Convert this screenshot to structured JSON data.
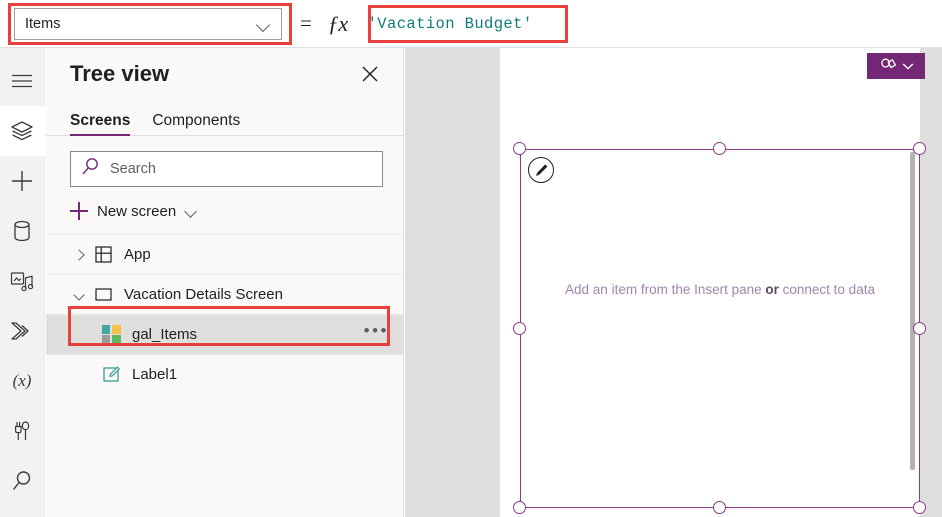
{
  "formula_bar": {
    "property_label": "Items",
    "property_options": [
      "Items"
    ],
    "equals_symbol": "=",
    "fx_symbol": "ƒx",
    "formula_value": "'Vacation Budget'",
    "formula_placeholder": "",
    "dropdown_icon": "chevron-down-icon"
  },
  "rail": {
    "items": [
      {
        "name": "hamburger-menu",
        "icon": "hamburger-icon",
        "active": false
      },
      {
        "name": "tree-view",
        "icon": "layers-icon",
        "active": true
      },
      {
        "name": "insert",
        "icon": "plus-icon",
        "active": false
      },
      {
        "name": "data",
        "icon": "database-icon",
        "active": false
      },
      {
        "name": "media",
        "icon": "media-icon",
        "active": false
      },
      {
        "name": "power-automate",
        "icon": "flow-icon",
        "active": false
      },
      {
        "name": "variables",
        "icon": "variable-x-icon",
        "active": false
      },
      {
        "name": "advanced-tools",
        "icon": "tools-icon",
        "active": false
      },
      {
        "name": "search",
        "icon": "search-icon",
        "active": false
      }
    ]
  },
  "panel": {
    "title": "Tree view",
    "close_icon": "close-icon",
    "tabs": [
      {
        "label": "Screens",
        "active": true
      },
      {
        "label": "Components",
        "active": false
      }
    ],
    "search": {
      "placeholder": "Search",
      "value": "",
      "icon": "search-icon"
    },
    "new_screen": {
      "label": "New screen",
      "plus_icon": "plus-icon",
      "chevron_icon": "chevron-down-icon"
    },
    "tree": [
      {
        "label": "App",
        "icon": "app-icon",
        "indent": 1,
        "twisty": "collapsed",
        "selected": false,
        "show_ellipsis": false
      },
      {
        "label": "Vacation Details Screen",
        "icon": "screen-icon",
        "indent": 1,
        "twisty": "expanded",
        "selected": false,
        "show_ellipsis": false
      },
      {
        "label": "gal_Items",
        "icon": "gallery-icon",
        "indent": 2,
        "twisty": "none",
        "selected": true,
        "show_ellipsis": true,
        "ellipsis_label": "•••"
      },
      {
        "label": "Label1",
        "icon": "label-icon",
        "indent": 2,
        "twisty": "none",
        "selected": false,
        "show_ellipsis": false
      }
    ]
  },
  "canvas": {
    "theme_button": {
      "icon": "theme-shapes-icon",
      "chevron_icon": "chevron-down-icon"
    },
    "gallery": {
      "empty_text_prefix": "Add an item from the Insert pane ",
      "empty_text_bold": "or",
      "empty_text_suffix": " connect to data",
      "edit_badge_icon": "pencil-icon",
      "scrollbar": "vertical-scrollbar",
      "selected": true
    }
  },
  "colors": {
    "accent_purple": "#742774",
    "selection_purple": "#8a3b8a",
    "annotation_red": "#e8413c",
    "formula_teal": "#0f7a7a",
    "canvas_gray": "#dededd",
    "panel_gray": "#faf9f8",
    "rail_gray": "#f3f2f1",
    "gallery_icon_teal": "#3fa8a0",
    "gallery_icon_yellow": "#f2c14a",
    "gallery_icon_gray": "#9b9b9b",
    "gallery_icon_green": "#5fb85f",
    "label_icon_teal": "#3a9b96"
  },
  "annotations": [
    {
      "name": "property-dropdown-highlight"
    },
    {
      "name": "formula-value-highlight"
    },
    {
      "name": "gal-items-row-highlight"
    }
  ]
}
